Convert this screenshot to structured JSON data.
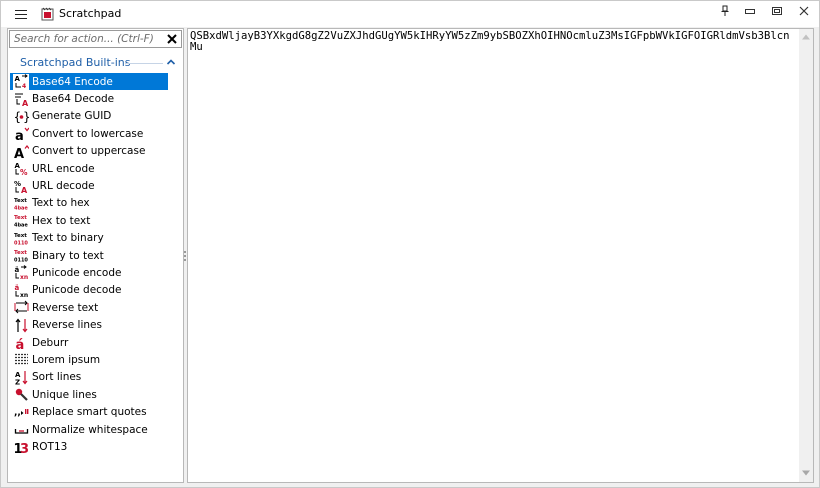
{
  "window": {
    "title": "Scratchpad"
  },
  "search": {
    "placeholder": "Search for action... (Ctrl-F)",
    "value": ""
  },
  "group": {
    "title": "Scratchpad Built-ins"
  },
  "items": [
    {
      "label": "Base64 Encode",
      "icon": "base64-encode-icon",
      "selected": true
    },
    {
      "label": "Base64 Decode",
      "icon": "base64-decode-icon"
    },
    {
      "label": "Generate GUID",
      "icon": "guid-braces-icon"
    },
    {
      "label": "Convert to lowercase",
      "icon": "lowercase-a-icon"
    },
    {
      "label": "Convert to uppercase",
      "icon": "uppercase-a-icon"
    },
    {
      "label": "URL encode",
      "icon": "url-encode-icon"
    },
    {
      "label": "URL decode",
      "icon": "url-decode-icon"
    },
    {
      "label": "Text to hex",
      "icon": "text-to-hex-icon"
    },
    {
      "label": "Hex to text",
      "icon": "hex-to-text-icon"
    },
    {
      "label": "Text to binary",
      "icon": "text-to-binary-icon"
    },
    {
      "label": "Binary to text",
      "icon": "binary-to-text-icon"
    },
    {
      "label": "Punicode encode",
      "icon": "punycode-encode-icon"
    },
    {
      "label": "Punicode decode",
      "icon": "punycode-decode-icon"
    },
    {
      "label": "Reverse text",
      "icon": "reverse-text-icon"
    },
    {
      "label": "Reverse lines",
      "icon": "reverse-lines-icon"
    },
    {
      "label": "Deburr",
      "icon": "deburr-accent-icon"
    },
    {
      "label": "Lorem ipsum",
      "icon": "lorem-ipsum-icon"
    },
    {
      "label": "Sort lines",
      "icon": "sort-az-icon"
    },
    {
      "label": "Unique lines",
      "icon": "unique-lines-icon"
    },
    {
      "label": "Replace smart quotes",
      "icon": "smart-quotes-icon"
    },
    {
      "label": "Normalize whitespace",
      "icon": "whitespace-icon"
    },
    {
      "label": "ROT13",
      "icon": "rot13-icon"
    }
  ],
  "editor": {
    "text": "QSBxdWljayB3YXkgdG8gZ2VuZXJhdGUgYW5kIHRyYW5zZm9ybSBOZXhOIHNOcmluZ3MsIGFpbWVkIGFOIGRldmVsb3BlcnMu"
  },
  "colors": {
    "accent": "#0078d7",
    "group_title": "#1f5fa8",
    "icon_red": "#c8102e"
  }
}
